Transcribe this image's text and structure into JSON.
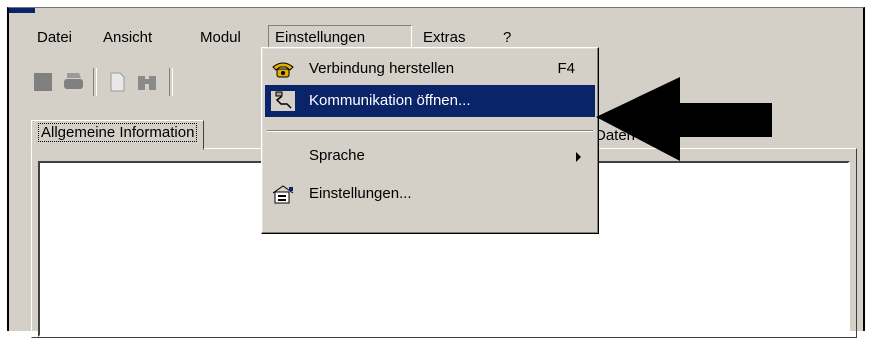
{
  "menubar": {
    "items": [
      "Datei",
      "Ansicht",
      "Modul",
      "Einstellungen",
      "Extras",
      "?"
    ]
  },
  "toolbar": {
    "icons": [
      "stop-icon",
      "print-icon",
      "document-icon",
      "binoculars-icon"
    ]
  },
  "tabs": {
    "active_label": "Allgemeine Information",
    "partial_label": "Daten"
  },
  "dropdown": {
    "items": [
      {
        "label": "Verbindung herstellen",
        "shortcut": "F4",
        "icon": "telephone-icon"
      },
      {
        "label": "Kommunikation öffnen...",
        "icon": "cable-icon",
        "highlighted": true
      },
      {
        "label": "Sprache",
        "submenu": true
      },
      {
        "label": "Einstellungen...",
        "icon": "settings-dialog-icon"
      }
    ]
  },
  "colors": {
    "window_face": "#d4d0c8",
    "highlight": "#0a246a",
    "arrow": "#000000"
  }
}
